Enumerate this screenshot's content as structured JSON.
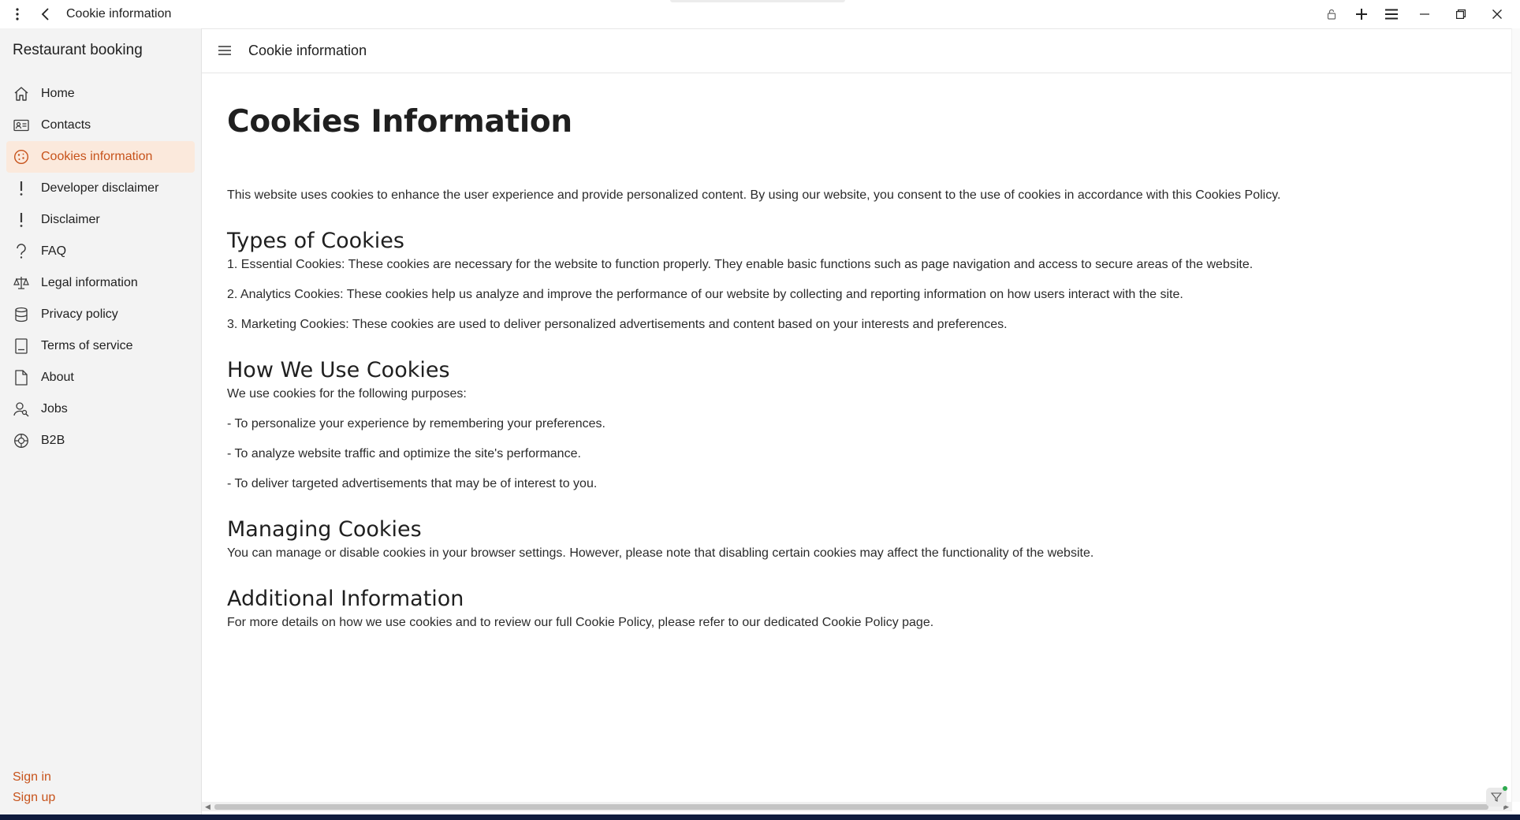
{
  "window": {
    "title": "Cookie information"
  },
  "sidebar": {
    "app_title": "Restaurant booking",
    "items": [
      {
        "label": "Home",
        "icon": "home-icon"
      },
      {
        "label": "Contacts",
        "icon": "contact-card-icon"
      },
      {
        "label": "Cookies information",
        "icon": "cookie-icon",
        "active": true
      },
      {
        "label": "Developer disclaimer",
        "icon": "exclamation-icon"
      },
      {
        "label": "Disclaimer",
        "icon": "exclamation-icon"
      },
      {
        "label": "FAQ",
        "icon": "question-icon"
      },
      {
        "label": "Legal information",
        "icon": "scales-icon"
      },
      {
        "label": "Privacy policy",
        "icon": "database-icon"
      },
      {
        "label": "Terms of service",
        "icon": "document-list-icon"
      },
      {
        "label": "About",
        "icon": "page-icon"
      },
      {
        "label": "Jobs",
        "icon": "person-search-icon"
      },
      {
        "label": "B2B",
        "icon": "globe-icon"
      }
    ],
    "sign_in": "Sign in",
    "sign_up": "Sign up"
  },
  "header": {
    "title": "Cookie information"
  },
  "content": {
    "heading": "Cookies Information",
    "intro": "This website uses cookies to enhance the user experience and provide personalized content. By using our website, you consent to the use of cookies in accordance with this Cookies Policy.",
    "types": {
      "heading": "Types of Cookies",
      "items": [
        "1. Essential Cookies: These cookies are necessary for the website to function properly. They enable basic functions such as page navigation and access to secure areas of the website.",
        "2. Analytics Cookies: These cookies help us analyze and improve the performance of our website by collecting and reporting information on how users interact with the site.",
        "3. Marketing Cookies: These cookies are used to deliver personalized advertisements and content based on your interests and preferences."
      ]
    },
    "usage": {
      "heading": "How We Use Cookies",
      "lead": "We use cookies for the following purposes:",
      "items": [
        "- To personalize your experience by remembering your preferences.",
        "- To analyze website traffic and optimize the site's performance.",
        "- To deliver targeted advertisements that may be of interest to you."
      ]
    },
    "managing": {
      "heading": "Managing Cookies",
      "text": "You can manage or disable cookies in your browser settings. However, please note that disabling certain cookies may affect the functionality of the website."
    },
    "additional": {
      "heading": "Additional Information",
      "text": "For more details on how we use cookies and to review our full Cookie Policy, please refer to our dedicated Cookie Policy page."
    }
  },
  "colors": {
    "accent": "#c7531b",
    "active_bg": "#fbe9dc",
    "sidebar_bg": "#f3f3f3"
  }
}
